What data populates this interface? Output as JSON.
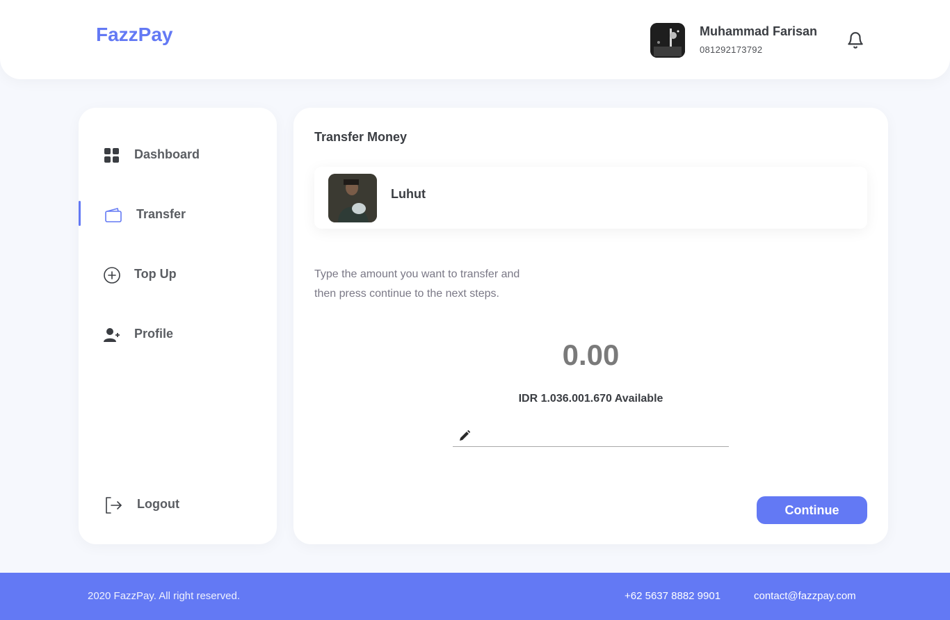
{
  "header": {
    "brand": "FazzPay",
    "user_name": "Muhammad Farisan",
    "user_phone": "081292173792",
    "bell_icon": "bell-icon"
  },
  "sidebar": {
    "items": [
      {
        "label": "Dashboard",
        "icon": "grid-icon"
      },
      {
        "label": "Transfer",
        "icon": "wallet-icon",
        "active": true
      },
      {
        "label": "Top Up",
        "icon": "plus-circle-icon"
      },
      {
        "label": "Profile",
        "icon": "user-plus-icon"
      }
    ],
    "logout": {
      "label": "Logout",
      "icon": "logout-icon"
    }
  },
  "main": {
    "title": "Transfer Money",
    "receiver": {
      "name": "Luhut"
    },
    "instruction": "Type the amount you want to transfer and then press continue to the next steps.",
    "amount": "0.00",
    "available": "IDR 1.036.001.670 Available",
    "note_placeholder": "",
    "continue_label": "Continue"
  },
  "footer": {
    "copyright": "2020 FazzPay. All right reserved.",
    "phone": "+62 5637 8882 9901",
    "email": "contact@fazzpay.com"
  },
  "colors": {
    "accent": "#6379f4",
    "background": "#f6f8fd",
    "text": "#3a3d42"
  }
}
